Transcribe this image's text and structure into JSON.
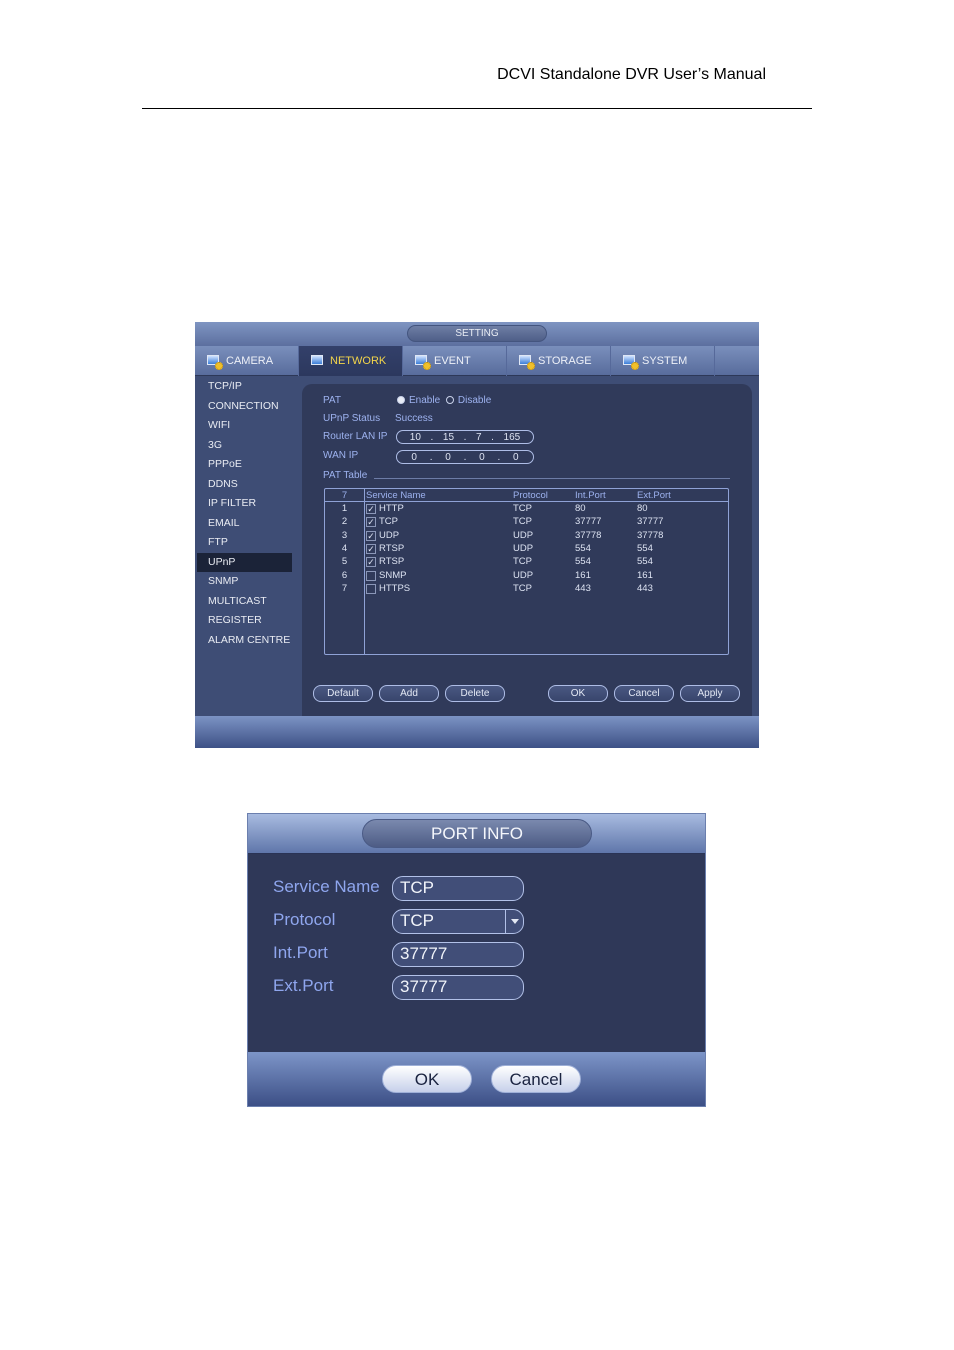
{
  "document": {
    "header": "DCVI Standalone DVR User’s Manual"
  },
  "setting_window": {
    "title": "SETTING",
    "tabs": [
      {
        "label": "CAMERA",
        "icon": "camera-gear-icon",
        "active": false
      },
      {
        "label": "NETWORK",
        "icon": "network-icon",
        "active": true
      },
      {
        "label": "EVENT",
        "icon": "event-gear-icon",
        "active": false
      },
      {
        "label": "STORAGE",
        "icon": "storage-gear-icon",
        "active": false
      },
      {
        "label": "SYSTEM",
        "icon": "system-monitor-gear-icon",
        "active": false
      }
    ],
    "sidebar": [
      {
        "label": "TCP/IP"
      },
      {
        "label": "CONNECTION"
      },
      {
        "label": "WIFI"
      },
      {
        "label": "3G"
      },
      {
        "label": "PPPoE"
      },
      {
        "label": "DDNS"
      },
      {
        "label": "IP FILTER"
      },
      {
        "label": "EMAIL"
      },
      {
        "label": "FTP"
      },
      {
        "label": "UPnP",
        "active": true
      },
      {
        "label": "SNMP"
      },
      {
        "label": "MULTICAST"
      },
      {
        "label": "REGISTER"
      },
      {
        "label": "ALARM CENTRE"
      }
    ],
    "form": {
      "pat_label": "PAT",
      "pat_enable": "Enable",
      "pat_disable": "Disable",
      "pat_selected": "Enable",
      "status_label": "UPnP Status",
      "status_value": "Success",
      "router_lan_ip_label": "Router LAN IP",
      "router_lan_ip": [
        "10",
        "15",
        "7",
        "165"
      ],
      "wan_ip_label": "WAN IP",
      "wan_ip": [
        "0",
        "0",
        "0",
        "0"
      ],
      "pat_table_label": "PAT Table"
    },
    "pat_table": {
      "headers": {
        "count": "7",
        "service_name": "Service Name",
        "protocol": "Protocol",
        "int_port": "Int.Port",
        "ext_port": "Ext.Port"
      },
      "rows": [
        {
          "num": "1",
          "checked": true,
          "name": "HTTP",
          "protocol": "TCP",
          "int_port": "80",
          "ext_port": "80"
        },
        {
          "num": "2",
          "checked": true,
          "name": "TCP",
          "protocol": "TCP",
          "int_port": "37777",
          "ext_port": "37777"
        },
        {
          "num": "3",
          "checked": true,
          "name": "UDP",
          "protocol": "UDP",
          "int_port": "37778",
          "ext_port": "37778"
        },
        {
          "num": "4",
          "checked": true,
          "name": "RTSP",
          "protocol": "UDP",
          "int_port": "554",
          "ext_port": "554"
        },
        {
          "num": "5",
          "checked": true,
          "name": "RTSP",
          "protocol": "TCP",
          "int_port": "554",
          "ext_port": "554"
        },
        {
          "num": "6",
          "checked": false,
          "name": "SNMP",
          "protocol": "UDP",
          "int_port": "161",
          "ext_port": "161"
        },
        {
          "num": "7",
          "checked": false,
          "name": "HTTPS",
          "protocol": "TCP",
          "int_port": "443",
          "ext_port": "443"
        }
      ]
    },
    "buttons": {
      "default": "Default",
      "add": "Add",
      "delete": "Delete",
      "ok": "OK",
      "cancel": "Cancel",
      "apply": "Apply"
    }
  },
  "port_info_dialog": {
    "title": "PORT INFO",
    "service_name_label": "Service Name",
    "service_name_value": "TCP",
    "protocol_label": "Protocol",
    "protocol_value": "TCP",
    "int_port_label": "Int.Port",
    "int_port_value": "37777",
    "ext_port_label": "Ext.Port",
    "ext_port_value": "37777",
    "ok_label": "OK",
    "cancel_label": "Cancel"
  },
  "colors": {
    "active_tab_text": "#f3d54a",
    "label_blue": "#9db2ef",
    "panel_bg": "#303a5a"
  }
}
